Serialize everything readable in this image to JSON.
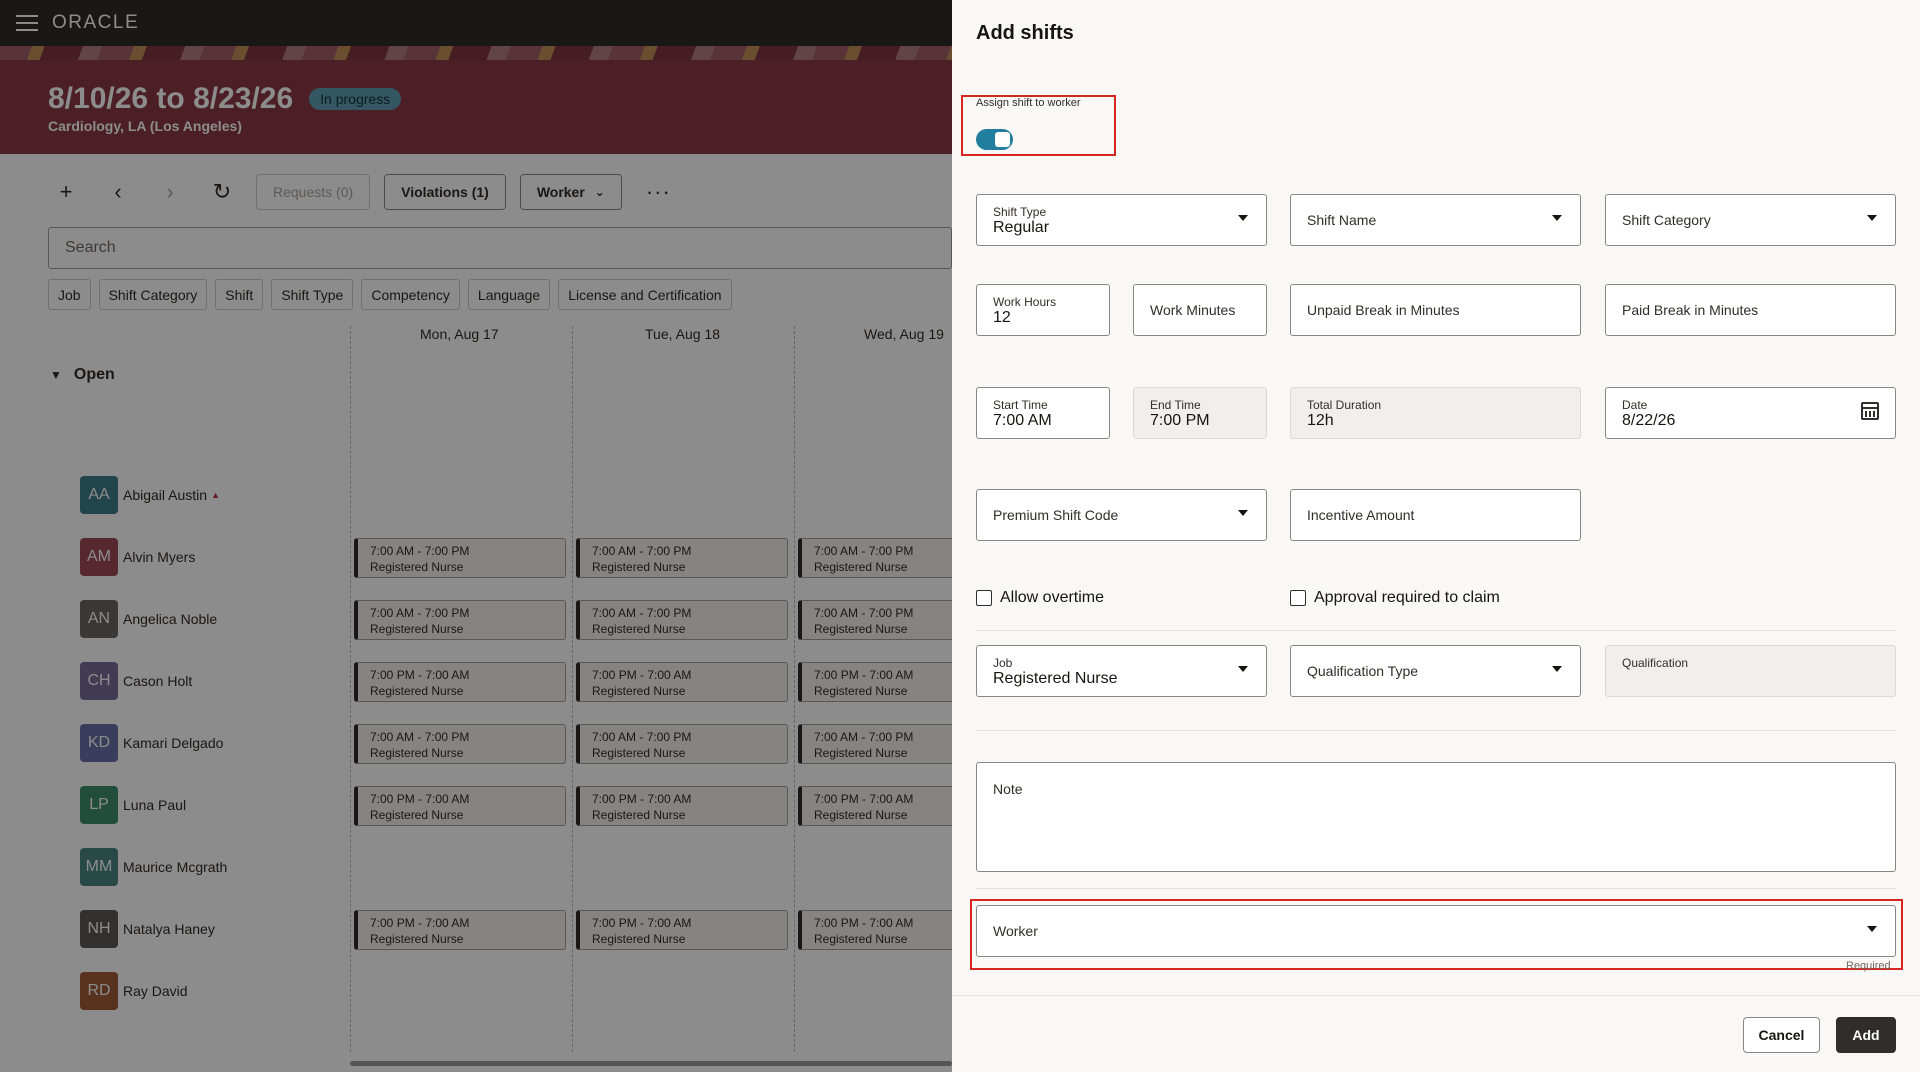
{
  "topbar": {
    "logo": "ORACLE"
  },
  "banner": {
    "title": "8/10/26 to 8/23/26",
    "status": "In progress",
    "subtitle": "Cardiology, LA (Los Angeles)"
  },
  "toolbar": {
    "requests": "Requests (0)",
    "violations": "Violations (1)",
    "worker": "Worker",
    "more": "···"
  },
  "search": {
    "placeholder": "Search"
  },
  "chips": [
    "Job",
    "Shift Category",
    "Shift",
    "Shift Type",
    "Competency",
    "Language",
    "License and Certification"
  ],
  "days": [
    "Mon, Aug 17",
    "Tue, Aug 18",
    "Wed, Aug 19"
  ],
  "group": {
    "label": "Open"
  },
  "workers": [
    {
      "initials": "AA",
      "name": "Abigail Austin",
      "color": "#3f7d8c",
      "shifts": []
    },
    {
      "initials": "AM",
      "name": "Alvin Myers",
      "color": "#a14a5a",
      "shifts": [
        "7:00 AM - 7:00 PM",
        "7:00 AM - 7:00 PM",
        "7:00 AM - 7:00 PM"
      ]
    },
    {
      "initials": "AN",
      "name": "Angelica Noble",
      "color": "#6b6560",
      "shifts": [
        "7:00 AM - 7:00 PM",
        "7:00 AM - 7:00 PM",
        "7:00 AM - 7:00 PM"
      ]
    },
    {
      "initials": "CH",
      "name": "Cason Holt",
      "color": "#7a6b9a",
      "shifts": [
        "7:00 PM - 7:00 AM",
        "7:00 PM - 7:00 AM",
        "7:00 PM - 7:00 AM"
      ]
    },
    {
      "initials": "KD",
      "name": "Kamari Delgado",
      "color": "#6b6fa8",
      "shifts": [
        "7:00 AM - 7:00 PM",
        "7:00 AM - 7:00 PM",
        "7:00 AM - 7:00 PM"
      ]
    },
    {
      "initials": "LP",
      "name": "Luna Paul",
      "color": "#3f8c6a",
      "shifts": [
        "7:00 PM - 7:00 AM",
        "7:00 PM - 7:00 AM",
        "7:00 PM - 7:00 AM"
      ]
    },
    {
      "initials": "MM",
      "name": "Maurice Mcgrath",
      "color": "#4a8580",
      "shifts": []
    },
    {
      "initials": "NH",
      "name": "Natalya Haney",
      "color": "#5d5a57",
      "shifts": [
        "7:00 PM - 7:00 AM",
        "7:00 PM - 7:00 AM",
        "7:00 PM - 7:00 AM"
      ]
    },
    {
      "initials": "RD",
      "name": "Ray David",
      "color": "#a05a3a",
      "shifts": []
    }
  ],
  "shift_role": "Registered Nurse",
  "drawer": {
    "title": "Add shifts",
    "assign_label": "Assign shift to worker",
    "shift_type": {
      "label": "Shift Type",
      "value": "Regular"
    },
    "shift_name": "Shift Name",
    "shift_category": "Shift Category",
    "work_hours": {
      "label": "Work Hours",
      "value": "12"
    },
    "work_minutes": "Work Minutes",
    "unpaid_break": "Unpaid Break in Minutes",
    "paid_break": "Paid Break in Minutes",
    "start_time": {
      "label": "Start Time",
      "value": "7:00 AM"
    },
    "end_time": {
      "label": "End Time",
      "value": "7:00 PM"
    },
    "total_duration": {
      "label": "Total Duration",
      "value": "12h"
    },
    "date": {
      "label": "Date",
      "value": "8/22/26"
    },
    "premium_code": "Premium Shift Code",
    "incentive": "Incentive Amount",
    "allow_overtime": "Allow overtime",
    "approval_required": "Approval required to claim",
    "job": {
      "label": "Job",
      "value": "Registered Nurse"
    },
    "qualification_type": "Qualification Type",
    "qualification": "Qualification",
    "note": "Note",
    "worker": "Worker",
    "required": "Required",
    "cancel": "Cancel",
    "add": "Add"
  }
}
